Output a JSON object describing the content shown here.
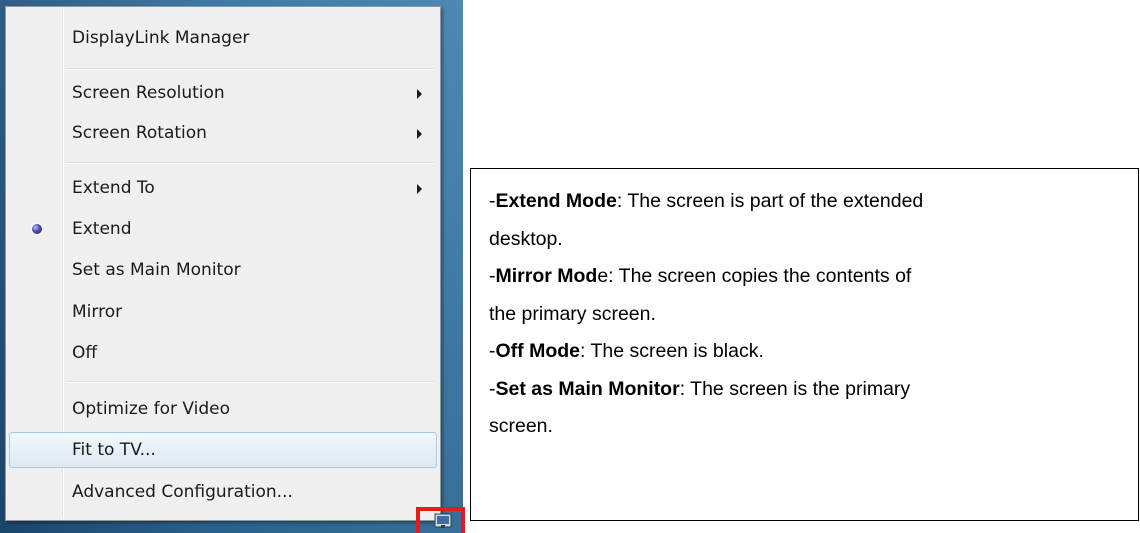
{
  "context_menu": {
    "items": [
      {
        "label": "DisplayLink Manager"
      },
      {
        "label": "Screen Resolution"
      },
      {
        "label": "Screen Rotation"
      },
      {
        "label": "Extend To"
      },
      {
        "label": "Extend"
      },
      {
        "label": "Set as Main Monitor"
      },
      {
        "label": "Mirror"
      },
      {
        "label": "Off"
      },
      {
        "label": "Optimize for Video"
      },
      {
        "label": "Fit to TV..."
      },
      {
        "label": "Advanced Configuration..."
      }
    ],
    "selected_radio": "Extend",
    "highlighted_item": "Fit to TV..."
  },
  "description": {
    "lines": [
      {
        "prefix": "-",
        "term": "Extend Mode",
        "text": ": The screen is part of the extended"
      },
      {
        "prefix": "",
        "term": "",
        "text": "desktop."
      },
      {
        "prefix": "-",
        "term": "Mirror Mod",
        "text": "e: The screen copies the contents of"
      },
      {
        "prefix": "",
        "term": "",
        "text": "the primary screen."
      },
      {
        "prefix": "-",
        "term": "Off Mode",
        "text": ": The screen is black."
      },
      {
        "prefix": "-",
        "term": "Set as Main Monitor",
        "text": ": The screen is the primary"
      },
      {
        "prefix": "",
        "term": "",
        "text": "screen."
      }
    ]
  },
  "colors": {
    "highlight_box": "#e21b1b",
    "menu_background": "#f0f0f0",
    "menu_hover": "#dde9f3"
  },
  "icons": {
    "radio": "radio-selected-icon",
    "submenu": "submenu-arrow-icon",
    "tray": "displaylink-tray-icon"
  }
}
